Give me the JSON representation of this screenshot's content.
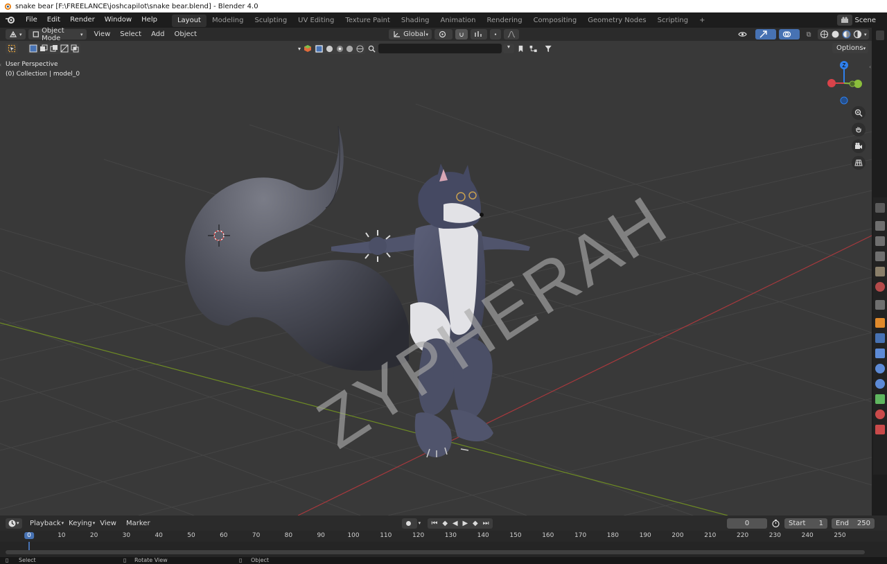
{
  "window": {
    "title": "snake bear [F:\\FREELANCE\\joshcapilot\\snake bear.blend] - Blender 4.0"
  },
  "menu": [
    "File",
    "Edit",
    "Render",
    "Window",
    "Help"
  ],
  "workspaces": [
    {
      "label": "Layout",
      "active": true
    },
    {
      "label": "Modeling"
    },
    {
      "label": "Sculpting"
    },
    {
      "label": "UV Editing"
    },
    {
      "label": "Texture Paint"
    },
    {
      "label": "Shading"
    },
    {
      "label": "Animation"
    },
    {
      "label": "Rendering"
    },
    {
      "label": "Compositing"
    },
    {
      "label": "Geometry Nodes"
    },
    {
      "label": "Scripting"
    }
  ],
  "add_workspace": "+",
  "scene": {
    "label": "Scene"
  },
  "viewport_header": {
    "mode": "Object Mode",
    "menus": [
      "View",
      "Select",
      "Add",
      "Object"
    ],
    "orientation": "Global",
    "options": "Options"
  },
  "viewport": {
    "perspective": "User Perspective",
    "collection": "(0) Collection | model_0",
    "watermark": "ZYPHERAH",
    "gizmo": {
      "z": "Z"
    }
  },
  "timeline": {
    "menus": [
      "Playback",
      "Keying",
      "View",
      "Marker"
    ],
    "current_frame": "0",
    "start_label": "Start",
    "start_value": "1",
    "end_label": "End",
    "end_value": "250",
    "ticks": [
      "0",
      "10",
      "20",
      "30",
      "40",
      "50",
      "60",
      "70",
      "80",
      "90",
      "100",
      "110",
      "120",
      "130",
      "140",
      "150",
      "160",
      "170",
      "180",
      "190",
      "200",
      "210",
      "220",
      "230",
      "240",
      "250"
    ]
  },
  "status": {
    "select": "Select",
    "rotate": "Rotate View",
    "object": "Object"
  },
  "colors": {
    "accent": "#4772b3",
    "x_axis": "#a8393d",
    "y_axis": "#6e8b24",
    "gizmo_z": "#2f80ed",
    "gizmo_y": "#8bbf3c",
    "gizmo_x": "#d9434a"
  }
}
